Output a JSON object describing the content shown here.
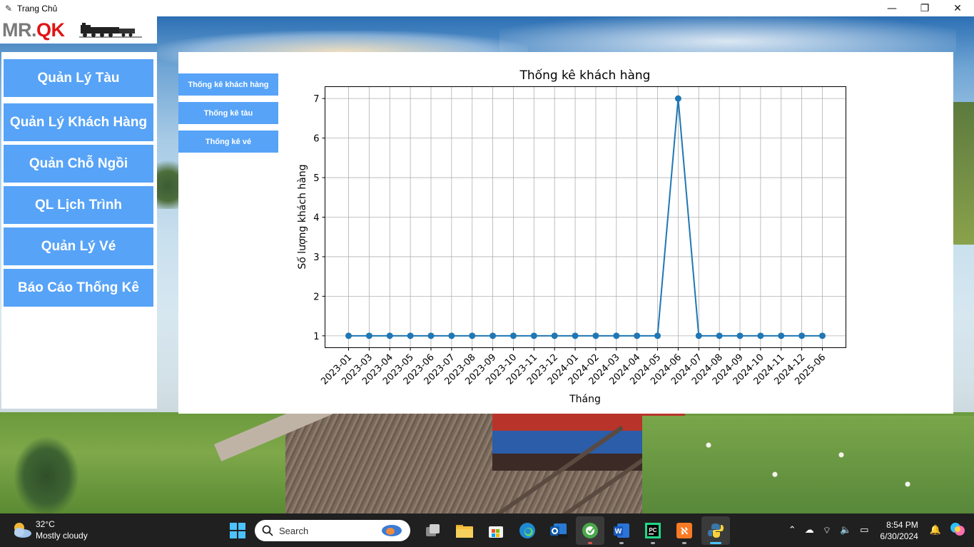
{
  "window": {
    "title": "Trang Chủ",
    "controls": [
      "—",
      "❐",
      "✕"
    ]
  },
  "logo": {
    "mr": "MR.",
    "qk": "QK"
  },
  "sidebar": {
    "items": [
      {
        "label": "Quản Lý Tàu"
      },
      {
        "label": "Quản Lý Khách Hàng"
      },
      {
        "label": "Quản Chỗ Ngồi"
      },
      {
        "label": "QL Lịch Trình"
      },
      {
        "label": "Quản Lý Vé"
      },
      {
        "label": "Báo Cáo Thống Kê"
      }
    ]
  },
  "report_tabs": [
    {
      "label": "Thống kê khách hàng"
    },
    {
      "label": "Thống kê tàu"
    },
    {
      "label": "Thống kê vé"
    }
  ],
  "chart_data": {
    "type": "line",
    "title": "Thống kê khách hàng",
    "xlabel": "Tháng",
    "ylabel": "Số lượng khách hàng",
    "categories": [
      "2023-01",
      "2023-03",
      "2023-04",
      "2023-05",
      "2023-06",
      "2023-07",
      "2023-08",
      "2023-09",
      "2023-10",
      "2023-11",
      "2023-12",
      "2024-01",
      "2024-02",
      "2024-03",
      "2024-04",
      "2024-05",
      "2024-06",
      "2024-07",
      "2024-08",
      "2024-09",
      "2024-10",
      "2024-11",
      "2024-12",
      "2025-06"
    ],
    "values": [
      1,
      1,
      1,
      1,
      1,
      1,
      1,
      1,
      1,
      1,
      1,
      1,
      1,
      1,
      1,
      1,
      7,
      1,
      1,
      1,
      1,
      1,
      1,
      1
    ],
    "yticks": [
      1,
      2,
      3,
      4,
      5,
      6,
      7
    ],
    "ylim": [
      0.7,
      7.3
    ],
    "grid": true,
    "color": "#1f77b4"
  },
  "taskbar": {
    "weather_temp": "32°C",
    "weather_desc": "Mostly cloudy",
    "search_placeholder": "Search",
    "time": "8:54 PM",
    "date": "6/30/2024"
  }
}
